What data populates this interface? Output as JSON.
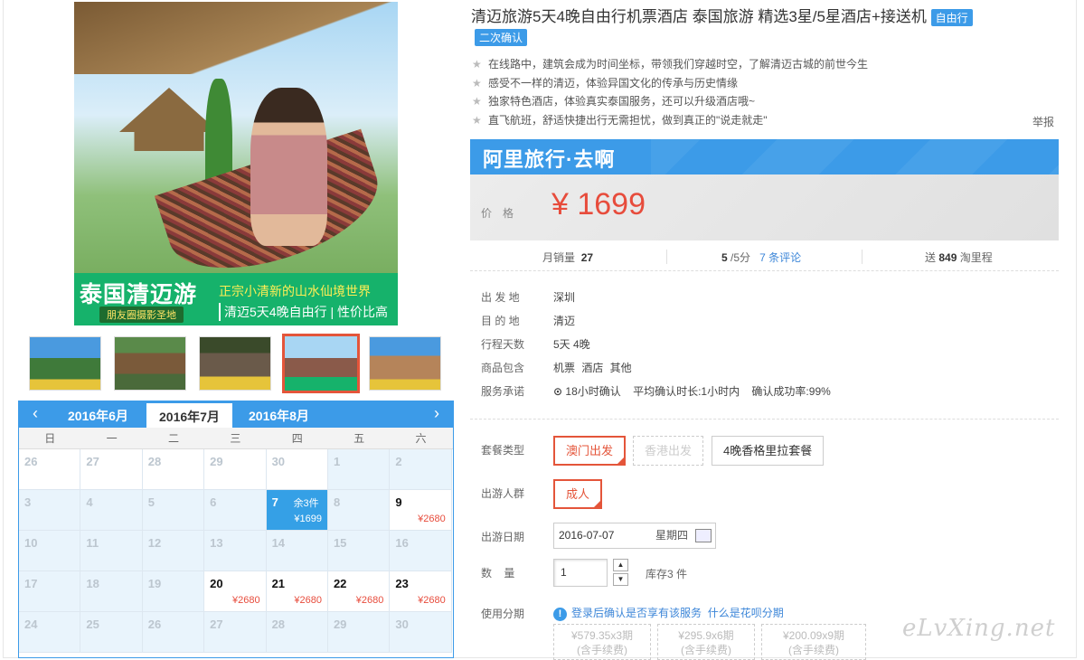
{
  "product": {
    "title": "清迈旅游5天4晚自由行机票酒店 泰国旅游 精选3星/5星酒店+接送机",
    "tag_free": "自由行",
    "tag_confirm": "二次确认",
    "features": [
      "在线路中，建筑会成为时间坐标，带领我们穿越时空，了解清迈古城的前世今生",
      "感受不一样的清迈，体验异国文化的传承与历史情缘",
      "独家特色酒店，体验真实泰国服务，还可以升级酒店哦~",
      "直飞航班，舒适快捷出行无需担忧，做到真正的\"说走就走\""
    ],
    "report": "举报"
  },
  "image": {
    "banner_title": "泰国清迈游",
    "banner_sub": "朋友圈摄影圣地",
    "banner_line1": "正宗小清新的山水仙境世界",
    "banner_line2": "清迈5天4晚自由行 | 性价比高"
  },
  "price": {
    "brand": "阿里旅行·去啊",
    "label": "价格",
    "value": "¥ 1699"
  },
  "stats": {
    "sales_label": "月销量",
    "sales": "27",
    "score": "5",
    "score_unit": "/5分",
    "reviews": "7 条评论",
    "miles_label": "送",
    "miles": "849",
    "miles_unit": "淘里程"
  },
  "info": [
    {
      "k": "出 发 地",
      "v": "深圳"
    },
    {
      "k": "目 的 地",
      "v": "清迈"
    },
    {
      "k": "行程天数",
      "v": "5天 4晚"
    },
    {
      "k": "商品包含",
      "v": "机票  酒店  其他"
    },
    {
      "k": "服务承诺",
      "v": "18小时确认    平均确认时长:1小时内    确认成功率:99%"
    }
  ],
  "options": {
    "package_label": "套餐类型",
    "packages": [
      "澳门出发",
      "香港出发",
      "4晚香格里拉套餐"
    ],
    "people_label": "出游人群",
    "people": "成人",
    "date_label": "出游日期",
    "date": "2016-07-07",
    "weekday": "星期四",
    "qty_label": "数    量",
    "qty": "1",
    "stock": "库存3 件",
    "installment_label": "使用分期",
    "installment_text": "登录后确认是否享有该服务",
    "installment_link": "什么是花呗分期",
    "installments": [
      {
        "amt": "¥579.35x3期",
        "fee": "(含手续费)"
      },
      {
        "amt": "¥295.9x6期",
        "fee": "(含手续费)"
      },
      {
        "amt": "¥200.09x9期",
        "fee": "(含手续费)"
      }
    ]
  },
  "calendar": {
    "months": [
      "2016年6月",
      "2016年7月",
      "2016年8月"
    ],
    "weekdays": [
      "日",
      "一",
      "二",
      "三",
      "四",
      "五",
      "六"
    ],
    "stock_text": "余3件",
    "selected_price": "¥1699",
    "price": "¥2680",
    "rows": [
      [
        "26",
        "27",
        "28",
        "29",
        "30",
        "1",
        "2"
      ],
      [
        "3",
        "4",
        "5",
        "6",
        "7",
        "8",
        "9"
      ],
      [
        "10",
        "11",
        "12",
        "13",
        "14",
        "15",
        "16"
      ],
      [
        "17",
        "18",
        "19",
        "20",
        "21",
        "22",
        "23"
      ],
      [
        "24",
        "25",
        "26",
        "27",
        "28",
        "29",
        "30"
      ]
    ]
  },
  "watermark": "eLvXing.net"
}
